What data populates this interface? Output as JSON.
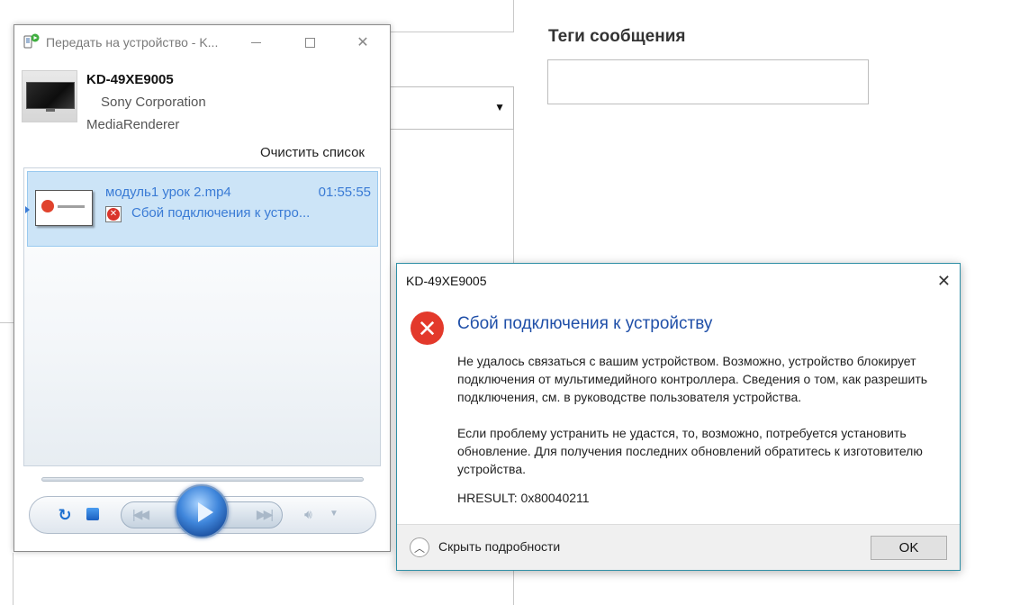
{
  "background": {
    "tags_heading": "Теги сообщения",
    "tags_input_value": "",
    "select_value": ""
  },
  "play_to": {
    "title": "Передать на устройство - K...",
    "device": {
      "name": "KD-49XE9005",
      "manufacturer": "Sony Corporation",
      "type": "MediaRenderer"
    },
    "clear_list_label": "Очистить список",
    "items": [
      {
        "filename": "модуль1 урок 2.mp4",
        "duration": "01:55:55",
        "status": "Сбой подключения к устро...",
        "status_icon": "error-icon"
      }
    ],
    "controls": {
      "repeat_icon": "repeat-icon",
      "stop_icon": "stop-icon",
      "prev_icon": "previous-icon",
      "play_icon": "play-icon",
      "next_icon": "next-icon",
      "volume_icon": "volume-icon"
    }
  },
  "dialog": {
    "title": "KD-49XE9005",
    "heading": "Сбой подключения к устройству",
    "paragraph1": "Не удалось связаться с вашим устройством. Возможно, устройство блокирует подключения от мультимедийного контроллера. Сведения о том, как разрешить подключения, см. в руководстве пользователя устройства.",
    "paragraph2": "Если проблему устранить не удастся, то, возможно, потребуется установить обновление. Для получения последних обновлений обратитесь к изготовителю устройства.",
    "hresult": "HRESULT: 0x80040211",
    "toggle_details_label": "Скрыть подробности",
    "ok_label": "OK"
  },
  "colors": {
    "accent_blue": "#3a7bd5",
    "heading_blue": "#1f4fa8",
    "error_red": "#e3392b",
    "selection_bg": "#cce4f7",
    "dialog_border": "#2f8fa6"
  }
}
